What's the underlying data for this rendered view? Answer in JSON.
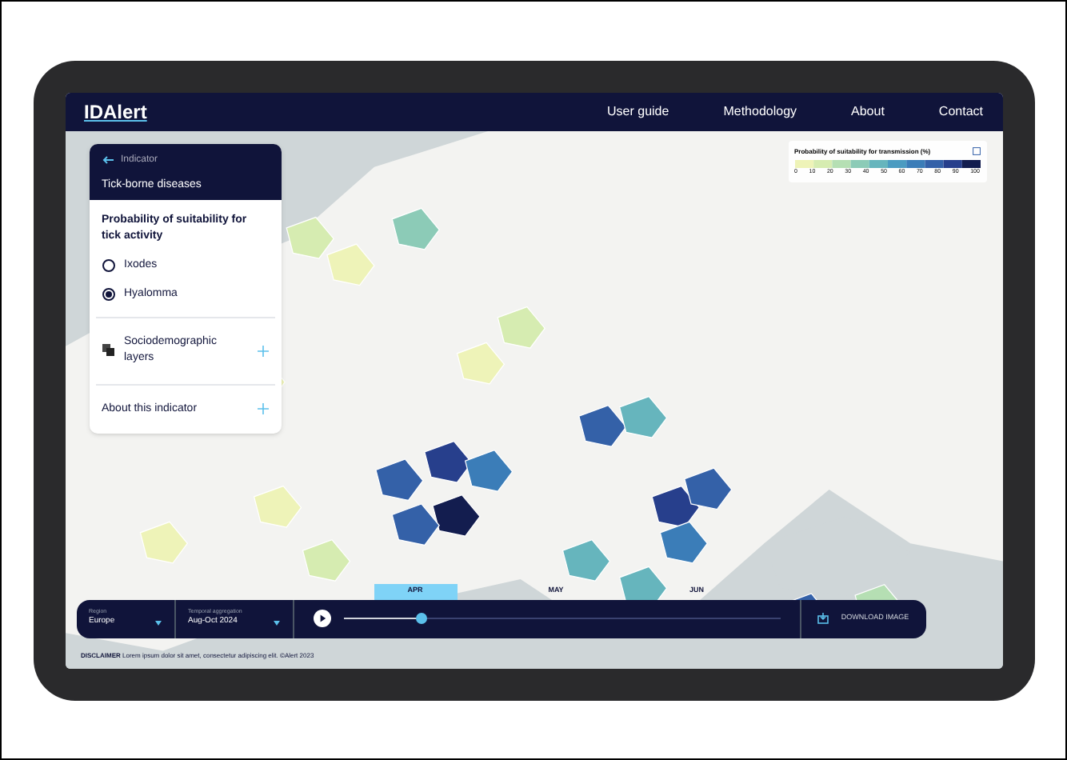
{
  "nav": {
    "logo": "IDAlert",
    "links": [
      "User guide",
      "Methodology",
      "About",
      "Contact"
    ]
  },
  "panel": {
    "back_label": "Indicator",
    "category": "Tick-borne diseases",
    "title": "Probability of suitability for tick activity",
    "options": [
      {
        "label": "Ixodes",
        "selected": false
      },
      {
        "label": "Hyalomma",
        "selected": true
      }
    ],
    "sections": [
      {
        "label": "Sociodemographic layers",
        "kind": "layers"
      },
      {
        "label": "About this indicator",
        "kind": "plain"
      }
    ]
  },
  "legend": {
    "title": "Probability of suitability for transmission (%)",
    "ticks": [
      "0",
      "10",
      "20",
      "30",
      "40",
      "50",
      "60",
      "70",
      "80",
      "90",
      "100"
    ]
  },
  "timeline": {
    "region_label": "Region",
    "region": "Europe",
    "period_label": "Temporal aggregation",
    "period": "Aug-Oct 2024",
    "months": [
      {
        "label": "APR",
        "selected": true
      },
      {
        "label": "MAY",
        "selected": false
      },
      {
        "label": "JUN",
        "selected": false
      }
    ],
    "level": 0.18,
    "download": "DOWNLOAD IMAGE"
  },
  "disclaimer": "**DISCLAIMER** Lorem ipsum dolor sit amet, consectetur adipiscing elit. ©Alert 2023"
}
